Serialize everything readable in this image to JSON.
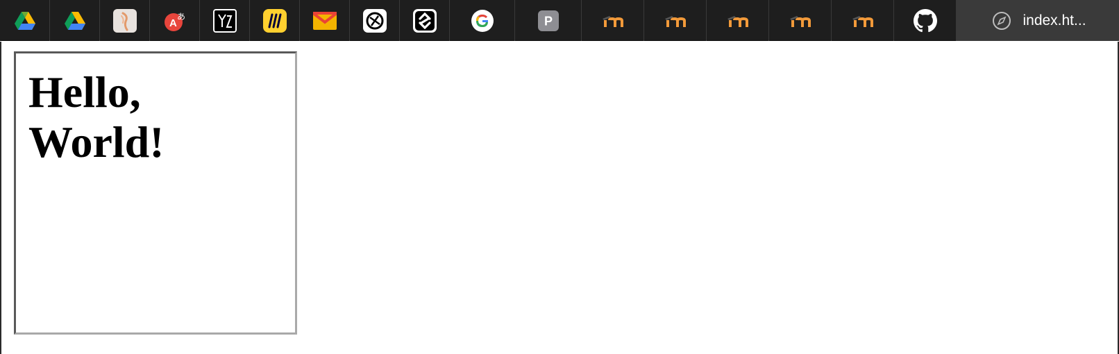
{
  "tabs": [
    {
      "icon": "google-drive-icon"
    },
    {
      "icon": "google-drive-icon"
    },
    {
      "icon": "brush-app-icon"
    },
    {
      "icon": "translate-icon"
    },
    {
      "icon": "monogram-app-icon"
    },
    {
      "icon": "miro-icon"
    },
    {
      "icon": "gmail-icon"
    },
    {
      "icon": "chatgpt-icon"
    },
    {
      "icon": "squarespace-icon"
    },
    {
      "icon": "google-icon"
    },
    {
      "icon": "p-app-icon",
      "letter": "P"
    },
    {
      "icon": "moodle-icon"
    },
    {
      "icon": "moodle-icon"
    },
    {
      "icon": "moodle-icon"
    },
    {
      "icon": "moodle-icon"
    },
    {
      "icon": "moodle-icon"
    },
    {
      "icon": "github-icon"
    }
  ],
  "active_tab": {
    "icon": "compass-icon",
    "title": "index.ht..."
  },
  "page": {
    "heading": "Hello, World!"
  },
  "colors": {
    "tabbar_bg": "#1e1e1e",
    "active_tab_bg": "#3a3a3a",
    "tab_divider": "#3a3a3a",
    "box_dark_border": "#595959",
    "box_light_border": "#a9a9a9",
    "moodle_orange": "#f29a3a"
  }
}
